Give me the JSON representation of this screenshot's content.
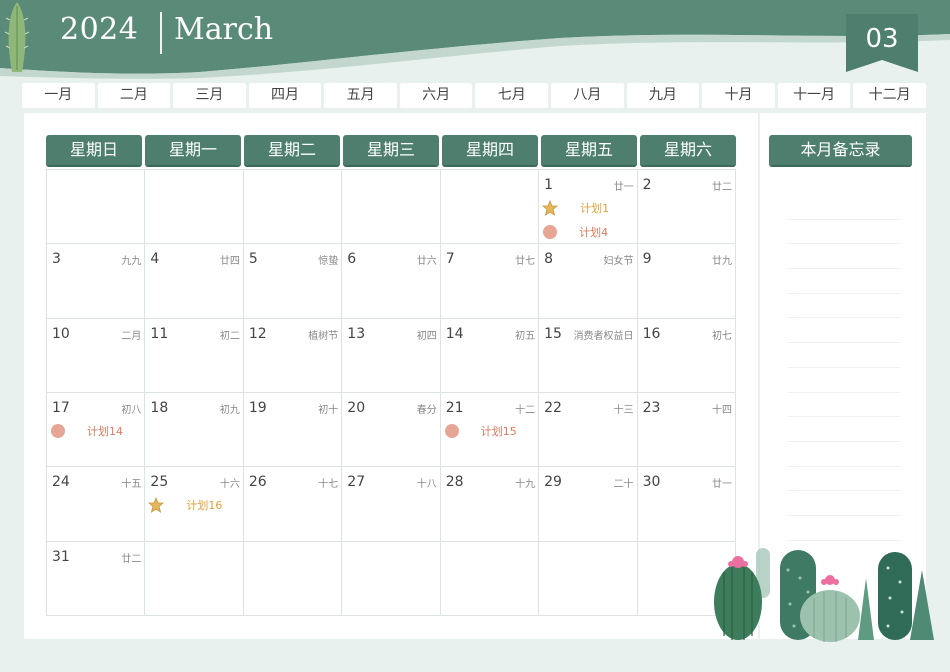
{
  "header": {
    "year": "2024",
    "month_name": "March",
    "month_number": "03"
  },
  "month_tabs": [
    "一月",
    "二月",
    "三月",
    "四月",
    "五月",
    "六月",
    "七月",
    "八月",
    "九月",
    "十月",
    "十一月",
    "十二月"
  ],
  "weekdays": [
    "星期日",
    "星期一",
    "星期二",
    "星期三",
    "星期四",
    "星期五",
    "星期六"
  ],
  "memo": {
    "title": "本月备忘录"
  },
  "days": [
    {
      "day": "",
      "lunar": ""
    },
    {
      "day": "",
      "lunar": ""
    },
    {
      "day": "",
      "lunar": ""
    },
    {
      "day": "",
      "lunar": ""
    },
    {
      "day": "",
      "lunar": ""
    },
    {
      "day": "1",
      "lunar": "廿一",
      "plans": [
        {
          "icon": "star-icon",
          "text": "计划1",
          "color": "gold"
        },
        {
          "icon": "dot-icon",
          "text": "计划4",
          "color": "red"
        }
      ]
    },
    {
      "day": "2",
      "lunar": "廿二"
    },
    {
      "day": "3",
      "lunar": "九九"
    },
    {
      "day": "4",
      "lunar": "廿四"
    },
    {
      "day": "5",
      "lunar": "惊蛰"
    },
    {
      "day": "6",
      "lunar": "廿六"
    },
    {
      "day": "7",
      "lunar": "廿七"
    },
    {
      "day": "8",
      "lunar": "妇女节"
    },
    {
      "day": "9",
      "lunar": "廿九"
    },
    {
      "day": "10",
      "lunar": "二月"
    },
    {
      "day": "11",
      "lunar": "初二"
    },
    {
      "day": "12",
      "lunar": "植树节"
    },
    {
      "day": "13",
      "lunar": "初四"
    },
    {
      "day": "14",
      "lunar": "初五"
    },
    {
      "day": "15",
      "lunar": "消费者权益日"
    },
    {
      "day": "16",
      "lunar": "初七"
    },
    {
      "day": "17",
      "lunar": "初八",
      "plans": [
        {
          "icon": "dot-icon",
          "text": "计划14",
          "color": "red"
        }
      ]
    },
    {
      "day": "18",
      "lunar": "初九"
    },
    {
      "day": "19",
      "lunar": "初十"
    },
    {
      "day": "20",
      "lunar": "春分"
    },
    {
      "day": "21",
      "lunar": "十二",
      "plans": [
        {
          "icon": "dot-icon",
          "text": "计划15",
          "color": "red"
        }
      ]
    },
    {
      "day": "22",
      "lunar": "十三"
    },
    {
      "day": "23",
      "lunar": "十四"
    },
    {
      "day": "24",
      "lunar": "十五"
    },
    {
      "day": "25",
      "lunar": "十六",
      "plans": [
        {
          "icon": "star-icon",
          "text": "计划16",
          "color": "gold"
        }
      ]
    },
    {
      "day": "26",
      "lunar": "十七"
    },
    {
      "day": "27",
      "lunar": "十八"
    },
    {
      "day": "28",
      "lunar": "十九"
    },
    {
      "day": "29",
      "lunar": "二十"
    },
    {
      "day": "30",
      "lunar": "廿一"
    },
    {
      "day": "31",
      "lunar": "廿二"
    },
    {
      "day": "",
      "lunar": ""
    },
    {
      "day": "",
      "lunar": ""
    },
    {
      "day": "",
      "lunar": ""
    },
    {
      "day": "",
      "lunar": ""
    },
    {
      "day": "",
      "lunar": ""
    },
    {
      "day": "",
      "lunar": ""
    }
  ],
  "colors": {
    "primary_green": "#4e7f6e",
    "background": "#e8f1ee",
    "plan_gold": "#e0a23c",
    "plan_red": "#d97b5f"
  }
}
